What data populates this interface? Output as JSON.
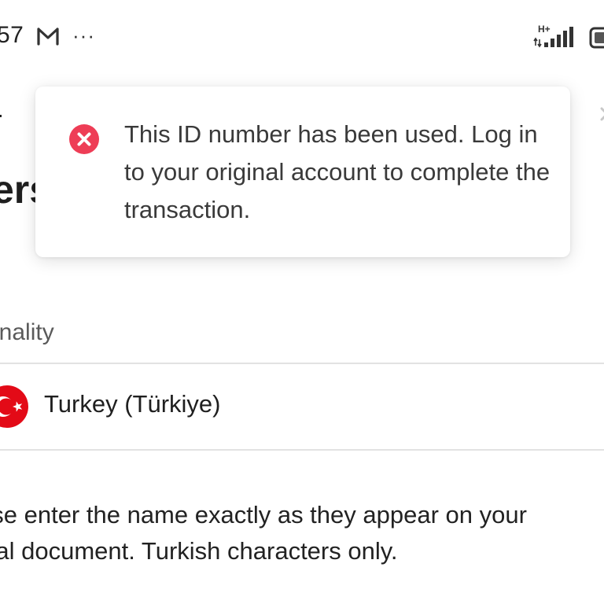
{
  "status_bar": {
    "time_fragment": "57",
    "more_label": "···",
    "network_type": "H+"
  },
  "page": {
    "heading_fragment": "ers",
    "field_label": "onality",
    "nationality_value": "Turkey (Türkiye)",
    "helper_line_1": "ase enter the name exactly as they appear on your",
    "helper_line_2": "cial document. Turkish characters only."
  },
  "toast": {
    "type": "error",
    "message": "This ID number has been used. Log in to your original account to complete the transaction."
  },
  "colors": {
    "error_red": "#ee3d56",
    "flag_red": "#e30a17",
    "divider": "#e2e2e2"
  },
  "icons": {
    "status_bar": [
      "gmail-icon",
      "more-icon",
      "signal-icon",
      "battery-icon"
    ],
    "toast": "error-icon",
    "nationality": "turkey-flag-icon"
  }
}
